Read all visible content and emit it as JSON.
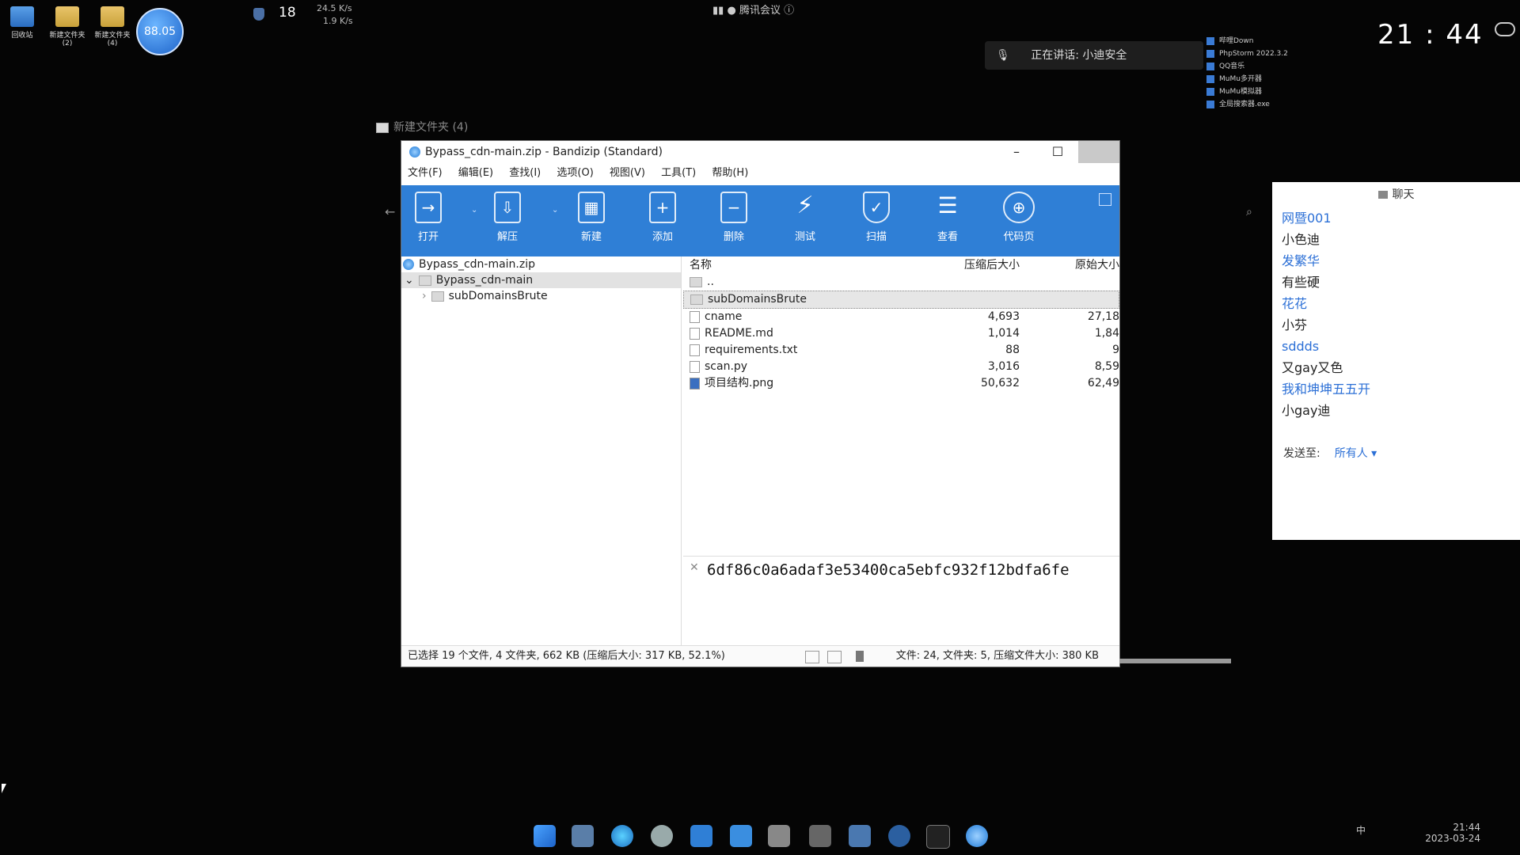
{
  "desktop": {
    "icons": [
      {
        "label": "回收站"
      },
      {
        "label": "新建文件夹 (2)"
      },
      {
        "label": "新建文件夹 (4)"
      }
    ],
    "ball_value": "88.05",
    "cpu_temp": "18",
    "net_up": "24.5 K/s",
    "net_down": "1.9 K/s"
  },
  "meeting": {
    "title": "腾讯会议",
    "speaking": "正在讲话: 小迪安全"
  },
  "widgets": {
    "clock": "21 : 44",
    "apps": [
      "哔哩Down",
      "PhpStorm 2022.3.2",
      "QQ音乐",
      "MuMu多开器",
      "MuMu模拟器",
      "全局搜索器.exe"
    ]
  },
  "chat": {
    "title": "聊天",
    "messages": [
      {
        "text": "网暨001",
        "style": "blue"
      },
      {
        "text": "小色迪",
        "style": "black"
      },
      {
        "text": "发繁华",
        "style": "blue"
      },
      {
        "text": "有些硬",
        "style": "black"
      },
      {
        "text": "花花",
        "style": "blue"
      },
      {
        "text": "小芬",
        "style": "black"
      },
      {
        "text": "sddds",
        "style": "blue"
      },
      {
        "text": "又gay又色",
        "style": "black"
      },
      {
        "text": "我和坤坤五五开",
        "style": "blue"
      },
      {
        "text": "小gay迪",
        "style": "black"
      }
    ],
    "send_to_label": "发送至:",
    "send_to_value": "所有人 ▾"
  },
  "background_window": {
    "title": "新建文件夹 (4)"
  },
  "bandizip": {
    "title": "Bypass_cdn-main.zip - Bandizip (Standard)",
    "menu": [
      "文件(F)",
      "编辑(E)",
      "查找(I)",
      "选项(O)",
      "视图(V)",
      "工具(T)",
      "帮助(H)"
    ],
    "toolbar": [
      {
        "label": "打开",
        "icon": "open-icon"
      },
      {
        "label": "解压",
        "icon": "extract-icon"
      },
      {
        "label": "新建",
        "icon": "new-archive-icon"
      },
      {
        "label": "添加",
        "icon": "add-file-icon"
      },
      {
        "label": "删除",
        "icon": "delete-file-icon"
      },
      {
        "label": "测试",
        "icon": "test-lightning-icon"
      },
      {
        "label": "扫描",
        "icon": "scan-shield-icon"
      },
      {
        "label": "查看",
        "icon": "view-list-icon"
      },
      {
        "label": "代码页",
        "icon": "codepage-globe-icon"
      }
    ],
    "tree": [
      {
        "label": "Bypass_cdn-main.zip",
        "level": 0
      },
      {
        "label": "Bypass_cdn-main",
        "level": 1
      },
      {
        "label": "subDomainsBrute",
        "level": 2
      }
    ],
    "columns": {
      "name": "名称",
      "packed": "压缩后大小",
      "original": "原始大小"
    },
    "files": [
      {
        "name": "..",
        "packed": "",
        "original": "",
        "type": "folder"
      },
      {
        "name": "subDomainsBrute",
        "packed": "",
        "original": "",
        "type": "folder"
      },
      {
        "name": "cname",
        "packed": "4,693",
        "original": "27,18",
        "type": "file"
      },
      {
        "name": "README.md",
        "packed": "1,014",
        "original": "1,84",
        "type": "file"
      },
      {
        "name": "requirements.txt",
        "packed": "88",
        "original": "9",
        "type": "file"
      },
      {
        "name": "scan.py",
        "packed": "3,016",
        "original": "8,59",
        "type": "file"
      },
      {
        "name": "项目结构.png",
        "packed": "50,632",
        "original": "62,49",
        "type": "file"
      }
    ],
    "hash": "6df86c0a6adaf3e53400ca5ebfc932f12bdfa6fe",
    "status_left": "已选择 19 个文件, 4 文件夹, 662 KB (压缩后大小: 317 KB, 52.1%)",
    "status_right": "文件: 24, 文件夹: 5, 压缩文件大小: 380 KB"
  },
  "taskbar": {
    "time": "21:44",
    "date": "2023-03-24",
    "ime": "中"
  }
}
